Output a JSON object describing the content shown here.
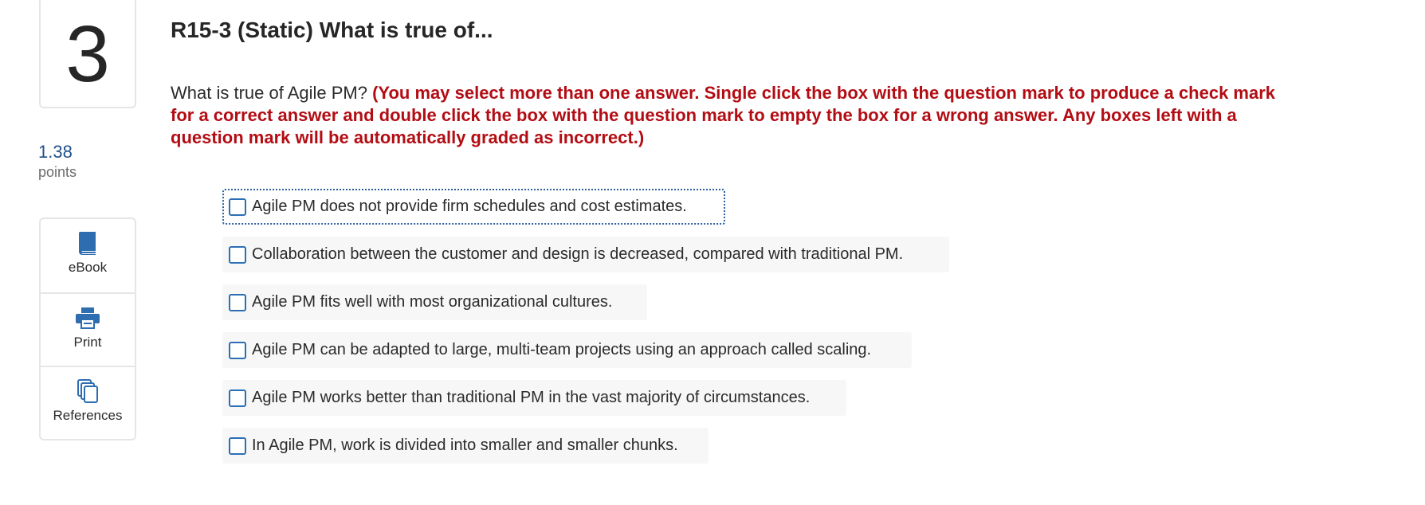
{
  "question": {
    "number": "3",
    "points_value": "1.38",
    "points_label": "points",
    "title": "R15-3 (Static) What is true of...",
    "prompt": "What is true of Agile PM? ",
    "instructions": "(You may select more than one answer. Single click the box with the question mark to produce a check mark for a correct answer and double click the box with the question mark to empty the box for a wrong answer. Any boxes left with a question mark will be automatically graded as incorrect.)"
  },
  "tools": [
    {
      "label": "eBook",
      "icon": "book-icon"
    },
    {
      "label": "Print",
      "icon": "printer-icon"
    },
    {
      "label": "References",
      "icon": "copy-documents-icon"
    }
  ],
  "options": [
    {
      "label": "Agile PM does not provide firm schedules and cost estimates.",
      "checked": false,
      "focused": true
    },
    {
      "label": "Collaboration between the customer and design is decreased, compared with traditional PM.",
      "checked": false
    },
    {
      "label": "Agile PM fits well with most organizational cultures.",
      "checked": false
    },
    {
      "label": "Agile PM can be adapted to large, multi-team projects using an approach called scaling.",
      "checked": false
    },
    {
      "label": "Agile PM works better than traditional PM in the vast majority of circumstances.",
      "checked": false
    },
    {
      "label": "In Agile PM, work is divided into smaller and smaller chunks.",
      "checked": false
    }
  ],
  "colors": {
    "instruction_red": "#b30d14",
    "link_blue": "#1f4f88",
    "checkbox_blue": "#2c6fb4",
    "icon_blue": "#2d6db0"
  }
}
